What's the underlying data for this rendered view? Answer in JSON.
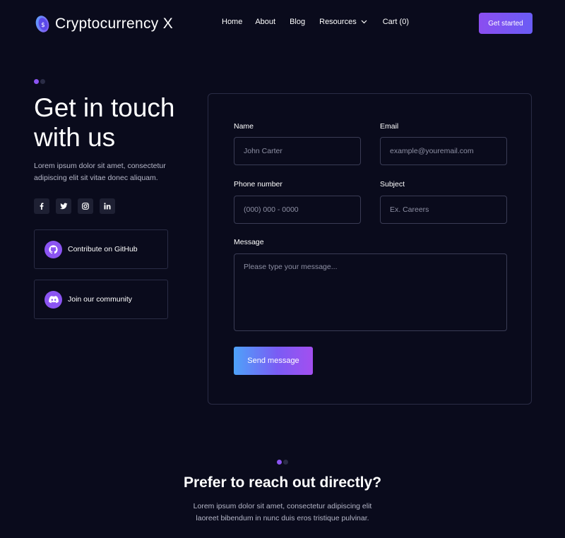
{
  "brand": {
    "name": "Cryptocurrency X",
    "logo_symbol": "$",
    "logo_icon": "coin-logo-icon"
  },
  "nav": {
    "items": [
      "Home",
      "About",
      "Blog",
      "Resources",
      "Cart (0)"
    ],
    "cta": "Get started"
  },
  "hero": {
    "title": "Get in touch with us",
    "description": "Lorem ipsum dolor sit amet, consectetur adipiscing elit sit vitae donec aliquam."
  },
  "socials": [
    "facebook-icon",
    "twitter-icon",
    "instagram-icon",
    "linkedin-icon"
  ],
  "links": [
    {
      "label": "Contribute on GitHub",
      "icon": "github-icon"
    },
    {
      "label": "Join our community",
      "icon": "discord-icon"
    }
  ],
  "form": {
    "name": {
      "label": "Name",
      "placeholder": "John Carter"
    },
    "email": {
      "label": "Email",
      "placeholder": "example@youremail.com"
    },
    "phone": {
      "label": "Phone number",
      "placeholder": "(000) 000 - 0000"
    },
    "subject": {
      "label": "Subject",
      "placeholder": "Ex. Careers"
    },
    "message": {
      "label": "Message",
      "placeholder": "Please type your message..."
    },
    "submit": "Send message"
  },
  "direct": {
    "title": "Prefer to reach out directly?",
    "description": "Lorem ipsum dolor sit amet, consectetur adipiscing elit laoreet bibendum in nunc duis eros tristique pulvinar."
  },
  "colors": {
    "background": "#0a0b1c",
    "accent": "#8b54f2",
    "border": "#2a2c45",
    "muted_text": "#b5b7c8"
  }
}
